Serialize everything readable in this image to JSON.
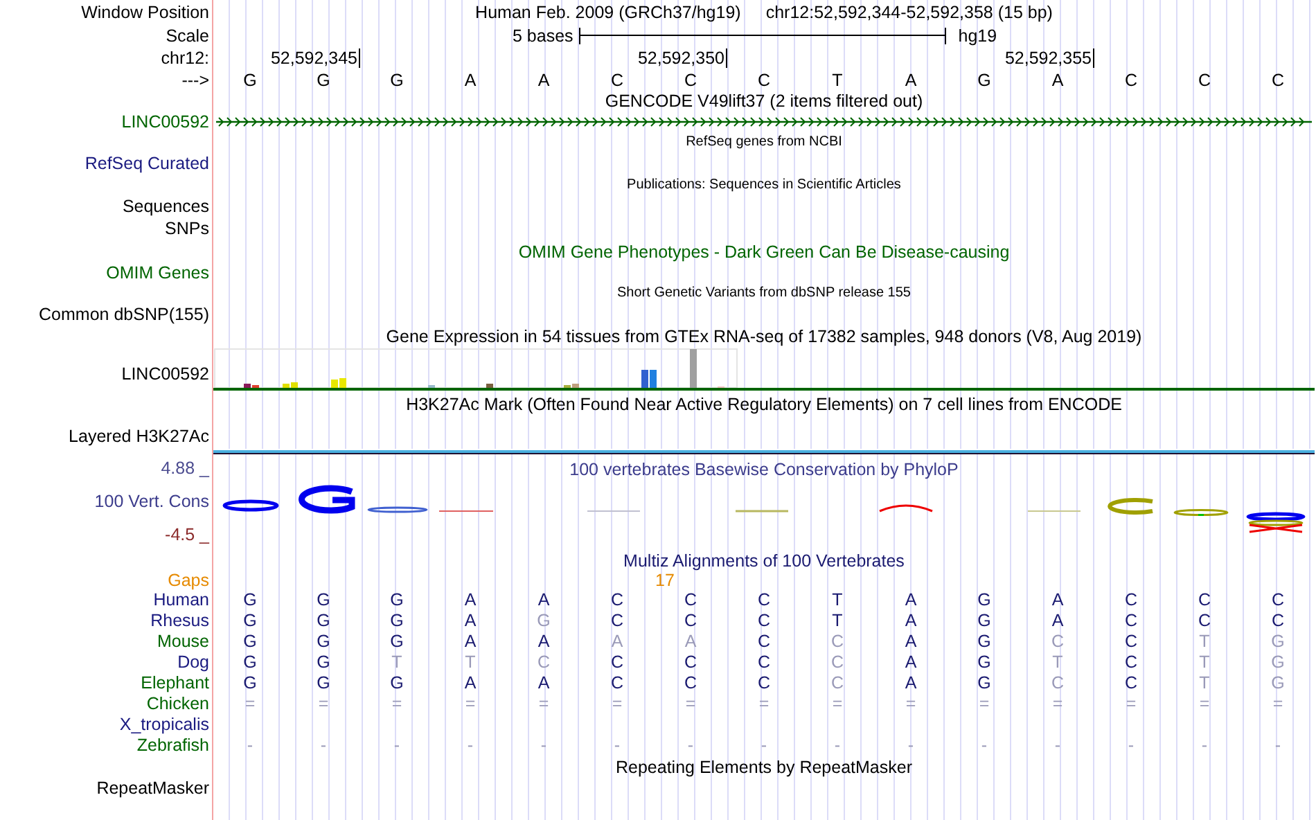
{
  "header": {
    "label": "Window Position",
    "assembly": "Human Feb. 2009 (GRCh37/hg19)",
    "range": "chr12:52,592,344-52,592,358 (15 bp)"
  },
  "scale": {
    "label": "Scale",
    "span": "5 bases",
    "assembly": "hg19"
  },
  "ruler": {
    "label": "chr12:",
    "ticks": [
      "52,592,345",
      "52,592,350",
      "52,592,355"
    ]
  },
  "sequence": {
    "label": "--->",
    "bases": [
      "G",
      "G",
      "G",
      "A",
      "A",
      "C",
      "C",
      "C",
      "T",
      "A",
      "G",
      "A",
      "C",
      "C",
      "C"
    ]
  },
  "tracks": [
    {
      "kind": "gene",
      "title": "GENCODE V49lift37 (2 items filtered out)",
      "label": "LINC00592",
      "color": "#006400"
    },
    {
      "kind": "note",
      "title": "RefSeq genes from NCBI",
      "label": "RefSeq Curated",
      "color": "#1a1a80"
    },
    {
      "kind": "note",
      "title": "Publications: Sequences in Scientific Articles",
      "label": "Sequences",
      "color": "#000000"
    },
    {
      "kind": "label",
      "label": "SNPs",
      "color": "#000000"
    },
    {
      "kind": "phenotype",
      "title": "OMIM Gene Phenotypes - Dark Green Can Be Disease-causing",
      "label": "OMIM Genes",
      "color": "#006400"
    },
    {
      "kind": "note",
      "title": "Short Genetic Variants from dbSNP release 155",
      "label": "Common dbSNP(155)",
      "color": "#000000"
    },
    {
      "kind": "expression",
      "title": "Gene Expression in 54 tissues from GTEx RNA-seq of 17382 samples, 948 donors (V8, Aug 2019)",
      "label": "LINC00592",
      "color": "#000000"
    },
    {
      "kind": "signal",
      "title": "H3K27Ac Mark (Often Found Near Active Regulatory Elements) on 7 cell lines from ENCODE",
      "label": "Layered H3K27Ac",
      "color": "#000000"
    },
    {
      "kind": "phylop",
      "title": "100 vertebrates Basewise Conservation by PhyloP",
      "label": "100 Vert. Cons",
      "color": "#3c3c8c",
      "max": "4.88 _",
      "min": "-4.5 _"
    },
    {
      "kind": "multiz",
      "title": "Multiz Alignments of 100 Vertebrates",
      "gaps": {
        "label": "Gaps",
        "count": "17"
      },
      "species": [
        {
          "name": "Human",
          "color": "#1a1a80",
          "bases": [
            {
              "base": "G",
              "matched": true
            },
            {
              "base": "G",
              "matched": true
            },
            {
              "base": "G",
              "matched": true
            },
            {
              "base": "A",
              "matched": true
            },
            {
              "base": "A",
              "matched": true
            },
            {
              "base": "C",
              "matched": true
            },
            {
              "base": "C",
              "matched": true
            },
            {
              "base": "C",
              "matched": true
            },
            {
              "base": "T",
              "matched": true
            },
            {
              "base": "A",
              "matched": true
            },
            {
              "base": "G",
              "matched": true
            },
            {
              "base": "A",
              "matched": true
            },
            {
              "base": "C",
              "matched": true
            },
            {
              "base": "C",
              "matched": true
            },
            {
              "base": "C",
              "matched": true
            }
          ]
        },
        {
          "name": "Rhesus",
          "color": "#1a1a80",
          "bases": [
            {
              "base": "G",
              "matched": true
            },
            {
              "base": "G",
              "matched": true
            },
            {
              "base": "G",
              "matched": true
            },
            {
              "base": "A",
              "matched": true
            },
            {
              "base": "G",
              "matched": false
            },
            {
              "base": "C",
              "matched": true
            },
            {
              "base": "C",
              "matched": true
            },
            {
              "base": "C",
              "matched": true
            },
            {
              "base": "T",
              "matched": true
            },
            {
              "base": "A",
              "matched": true
            },
            {
              "base": "G",
              "matched": true
            },
            {
              "base": "A",
              "matched": true
            },
            {
              "base": "C",
              "matched": true
            },
            {
              "base": "C",
              "matched": true
            },
            {
              "base": "C",
              "matched": true
            }
          ]
        },
        {
          "name": "Mouse",
          "color": "#006400",
          "bases": [
            {
              "base": "G",
              "matched": true
            },
            {
              "base": "G",
              "matched": true
            },
            {
              "base": "G",
              "matched": true
            },
            {
              "base": "A",
              "matched": true
            },
            {
              "base": "A",
              "matched": true
            },
            {
              "base": "A",
              "matched": false
            },
            {
              "base": "A",
              "matched": false
            },
            {
              "base": "C",
              "matched": true
            },
            {
              "base": "C",
              "matched": false
            },
            {
              "base": "A",
              "matched": true
            },
            {
              "base": "G",
              "matched": true
            },
            {
              "base": "C",
              "matched": false
            },
            {
              "base": "C",
              "matched": true
            },
            {
              "base": "T",
              "matched": false
            },
            {
              "base": "G",
              "matched": false
            }
          ]
        },
        {
          "name": "Dog",
          "color": "#1a1a80",
          "bases": [
            {
              "base": "G",
              "matched": true
            },
            {
              "base": "G",
              "matched": true
            },
            {
              "base": "T",
              "matched": false
            },
            {
              "base": "T",
              "matched": false
            },
            {
              "base": "C",
              "matched": false
            },
            {
              "base": "C",
              "matched": true
            },
            {
              "base": "C",
              "matched": true
            },
            {
              "base": "C",
              "matched": true
            },
            {
              "base": "C",
              "matched": false
            },
            {
              "base": "A",
              "matched": true
            },
            {
              "base": "G",
              "matched": true
            },
            {
              "base": "T",
              "matched": false
            },
            {
              "base": "C",
              "matched": true
            },
            {
              "base": "T",
              "matched": false
            },
            {
              "base": "G",
              "matched": false
            }
          ]
        },
        {
          "name": "Elephant",
          "color": "#006400",
          "bases": [
            {
              "base": "G",
              "matched": true
            },
            {
              "base": "G",
              "matched": true
            },
            {
              "base": "G",
              "matched": true
            },
            {
              "base": "A",
              "matched": true
            },
            {
              "base": "A",
              "matched": true
            },
            {
              "base": "C",
              "matched": true
            },
            {
              "base": "C",
              "matched": true
            },
            {
              "base": "C",
              "matched": true
            },
            {
              "base": "C",
              "matched": false
            },
            {
              "base": "A",
              "matched": true
            },
            {
              "base": "G",
              "matched": true
            },
            {
              "base": "C",
              "matched": false
            },
            {
              "base": "C",
              "matched": true
            },
            {
              "base": "T",
              "matched": false
            },
            {
              "base": "G",
              "matched": false
            }
          ]
        },
        {
          "name": "Chicken",
          "color": "#006400",
          "bases": [
            {
              "base": "=",
              "matched": false
            },
            {
              "base": "=",
              "matched": false
            },
            {
              "base": "=",
              "matched": false
            },
            {
              "base": "=",
              "matched": false
            },
            {
              "base": "=",
              "matched": false
            },
            {
              "base": "=",
              "matched": false
            },
            {
              "base": "=",
              "matched": false
            },
            {
              "base": "=",
              "matched": false
            },
            {
              "base": "=",
              "matched": false
            },
            {
              "base": "=",
              "matched": false
            },
            {
              "base": "=",
              "matched": false
            },
            {
              "base": "=",
              "matched": false
            },
            {
              "base": "=",
              "matched": false
            },
            {
              "base": "=",
              "matched": false
            },
            {
              "base": "=",
              "matched": false
            }
          ]
        },
        {
          "name": "X_tropicalis",
          "color": "#1a1a80"
        },
        {
          "name": "Zebrafish",
          "color": "#006400",
          "bases": [
            {
              "base": "-",
              "matched": false
            },
            {
              "base": "-",
              "matched": false
            },
            {
              "base": "-",
              "matched": false
            },
            {
              "base": "-",
              "matched": false
            },
            {
              "base": "-",
              "matched": false
            },
            {
              "base": "-",
              "matched": false
            },
            {
              "base": "-",
              "matched": false
            },
            {
              "base": "-",
              "matched": false
            },
            {
              "base": "-",
              "matched": false
            },
            {
              "base": "-",
              "matched": false
            },
            {
              "base": "-",
              "matched": false
            },
            {
              "base": "-",
              "matched": false
            },
            {
              "base": "-",
              "matched": false
            },
            {
              "base": "-",
              "matched": false
            },
            {
              "base": "-",
              "matched": false
            }
          ]
        }
      ]
    },
    {
      "kind": "feature",
      "title": "Repeating Elements by RepeatMasker",
      "label": "RepeatMasker",
      "color": "#000000"
    }
  ]
}
